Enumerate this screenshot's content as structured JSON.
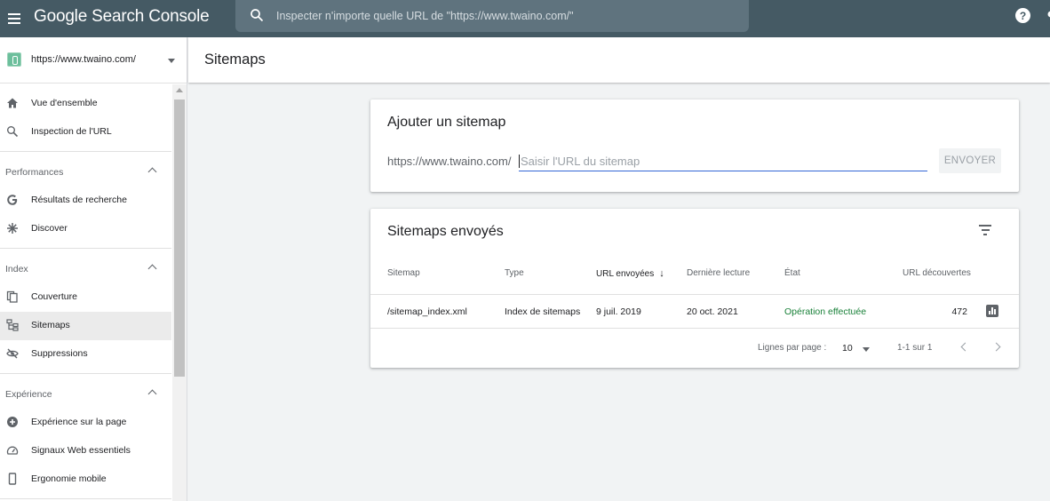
{
  "topbar": {
    "brand": "Google Search Console",
    "search_placeholder": "Inspecter n'importe quelle URL de \"https://www.twaino.com/\"",
    "help_glyph": "?"
  },
  "sidebar": {
    "property_url": "https://www.twaino.com/",
    "top_items": [
      {
        "label": "Vue d'ensemble",
        "icon": "home-icon"
      },
      {
        "label": "Inspection de l'URL",
        "icon": "search-icon"
      }
    ],
    "sections": [
      {
        "label": "Performances",
        "items": [
          {
            "label": "Résultats de recherche",
            "icon": "google-g-icon"
          },
          {
            "label": "Discover",
            "icon": "asterisk-icon"
          }
        ]
      },
      {
        "label": "Index",
        "items": [
          {
            "label": "Couverture",
            "icon": "copy-icon"
          },
          {
            "label": "Sitemaps",
            "icon": "sitemap-icon",
            "active": true
          },
          {
            "label": "Suppressions",
            "icon": "eye-off-icon"
          }
        ]
      },
      {
        "label": "Expérience",
        "items": [
          {
            "label": "Expérience sur la page",
            "icon": "add-circle-icon"
          },
          {
            "label": "Signaux Web essentiels",
            "icon": "speed-icon"
          },
          {
            "label": "Ergonomie mobile",
            "icon": "smartphone-icon"
          }
        ]
      }
    ]
  },
  "page": {
    "title": "Sitemaps"
  },
  "add_sitemap": {
    "title": "Ajouter un sitemap",
    "url_prefix": "https://www.twaino.com/",
    "input_placeholder": "Saisir l'URL du sitemap",
    "input_value": "",
    "submit_label": "ENVOYER"
  },
  "submitted": {
    "title": "Sitemaps envoyés",
    "columns": [
      "Sitemap",
      "Type",
      "URL envoyées",
      "Dernière lecture",
      "État",
      "URL découvertes"
    ],
    "sort_column": "URL envoyées",
    "rows": [
      {
        "sitemap": "/sitemap_index.xml",
        "type": "Index de sitemaps",
        "submitted": "9 juil. 2019",
        "last_read": "20 oct. 2021",
        "status": "Opération effectuée",
        "discovered": "472"
      }
    ],
    "pagination": {
      "rows_per_page_label": "Lignes par page :",
      "rows_per_page": "10",
      "range": "1-1 sur 1"
    }
  },
  "colors": {
    "topbar": "#455a64",
    "accent": "#3367d6",
    "success": "#188038"
  }
}
